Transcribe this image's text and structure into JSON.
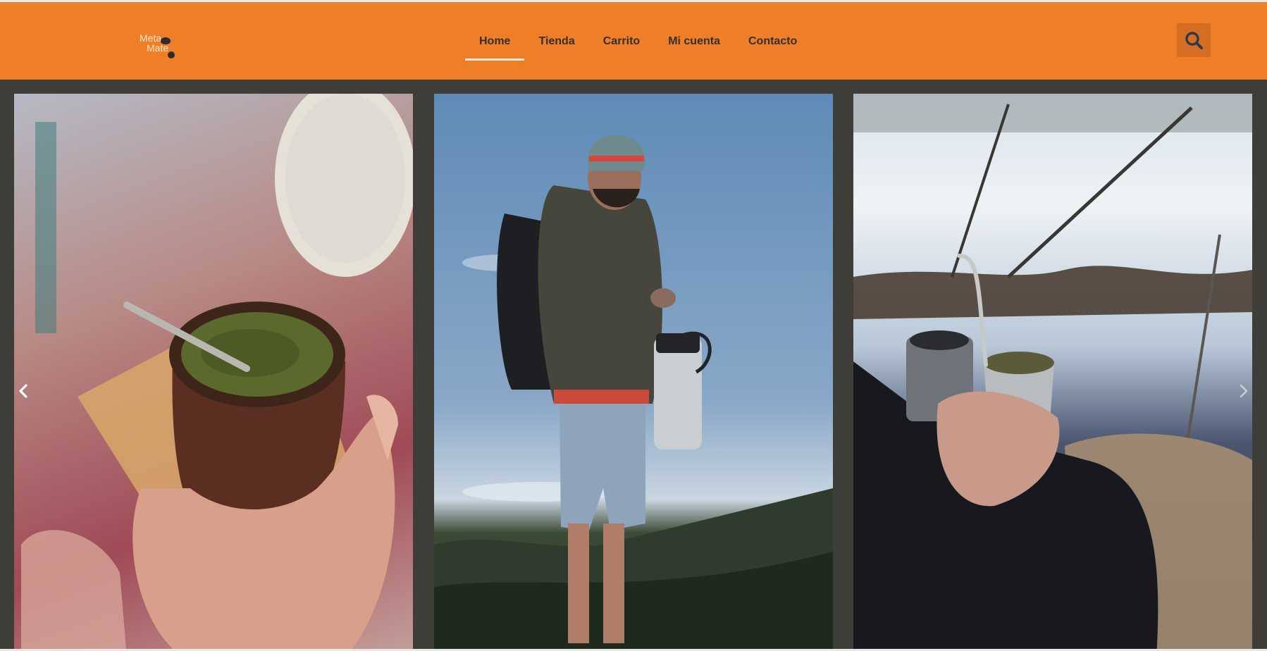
{
  "brand": {
    "logo_line1": "Meta",
    "logo_line2": "Mate"
  },
  "nav": {
    "items": [
      {
        "label": "Home"
      },
      {
        "label": "Tienda"
      },
      {
        "label": "Carrito"
      },
      {
        "label": "Mi cuenta"
      },
      {
        "label": "Contacto"
      }
    ],
    "active": "Home"
  },
  "icons": {
    "search": "search-icon",
    "prev": "chevron-left-icon",
    "next": "chevron-right-icon"
  },
  "colors": {
    "header_bg": "#ee7e28",
    "nav_text": "#33302c",
    "page_bg": "#3e3d38",
    "active_underline": "#f6ecdc"
  },
  "carousel": {
    "slides": [
      {
        "name": "mate-gourd-in-hand-photo"
      },
      {
        "name": "hiker-with-thermos-photo"
      },
      {
        "name": "mate-and-thermos-by-lake-photo"
      }
    ]
  }
}
